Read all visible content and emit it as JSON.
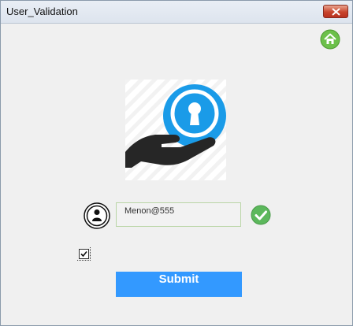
{
  "window": {
    "title": "User_Validation"
  },
  "icons": {
    "close": "close-icon",
    "home": "home-icon",
    "hero": "hand-keyhole-icon",
    "user": "user-icon",
    "valid": "check-icon",
    "checkbox_mark": "checkmark-icon"
  },
  "form": {
    "username_value": "Menon@555",
    "checkbox_checked": true,
    "submit_label": "Submit"
  },
  "colors": {
    "accent": "#3399ff",
    "hero_blue": "#1a9be8",
    "valid_green": "#5cb85c",
    "home_green": "#6cc04a"
  }
}
